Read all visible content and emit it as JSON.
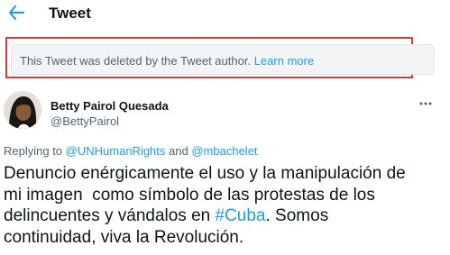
{
  "header": {
    "title": "Tweet",
    "back_icon": "arrow-left-icon",
    "accent_color": "#1d9bf0"
  },
  "deleted_notice": {
    "text": "This Tweet was deleted by the Tweet author.",
    "link": "Learn more",
    "highlight_color": "#e03c3c"
  },
  "author": {
    "name": "Betty Pairol Quesada",
    "handle": "@BettyPairol",
    "more_icon": "more-horizontal-icon"
  },
  "replying": {
    "prefix": "Replying to",
    "mention_1": "@UNHumanRights",
    "conjunction": "and",
    "mention_2": "@mbachelet"
  },
  "tweet": {
    "line1": "Denuncio enérgicamente el uso y la manipulación de",
    "line2": "mi imagen  como símbolo de las protestas de los",
    "line3_pre": "delincuentes y vándalos en",
    "hashtag": "#Cuba",
    "line3_post": ". Somos",
    "line4": "continuidad, viva la Revolución."
  }
}
